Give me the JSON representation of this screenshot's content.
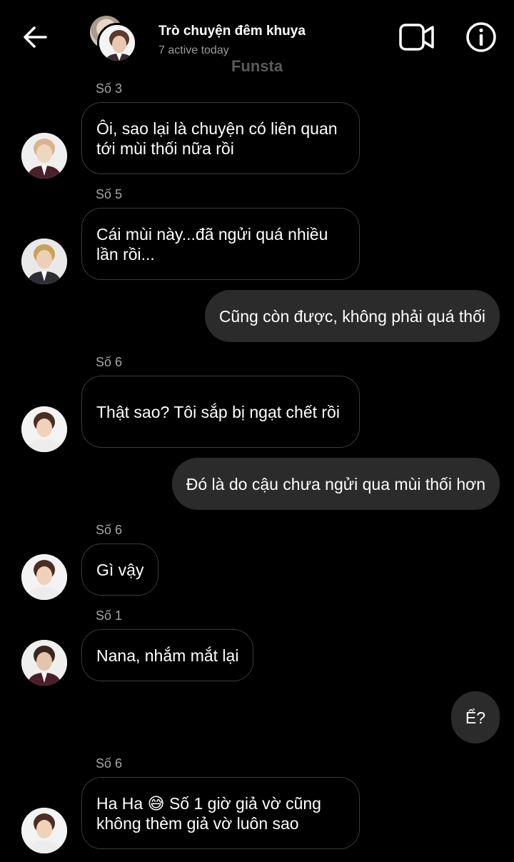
{
  "header": {
    "title": "Trò chuyện đêm khuya",
    "subtitle": "7 active today",
    "watermark": "Funsta",
    "back_icon": "arrow-left-icon",
    "video_icon": "video-camera-icon",
    "info_icon": "info-circle-icon"
  },
  "messages": [
    {
      "sender": "Số 3",
      "text": "Ôi, sao lại là chuyện có liên quan tới mùi thối nữa rồi"
    },
    {
      "sender": "Số 5",
      "text": "Cái mùi này...đã ngửi quá nhiều lần rồi..."
    },
    {
      "text": "Cũng còn được, không phải quá thối"
    },
    {
      "sender": "Số 6",
      "text": "Thật sao? Tôi sắp bị ngạt chết rồi"
    },
    {
      "text": "Đó là do cậu chưa ngửi qua mùi thối hơn"
    },
    {
      "sender": "Số 6",
      "text": "Gì vậy"
    },
    {
      "sender": "Số 1",
      "text": "Nana, nhắm mắt lại"
    },
    {
      "text": "Ể?"
    },
    {
      "sender": "Số 6",
      "text": "Ha Ha 😅 Số 1 giờ giả vờ cũng không thèm giả vờ luôn sao"
    }
  ],
  "colors": {
    "background": "#000000",
    "incoming_border": "#3a3a3a",
    "outgoing_fill": "#2b2b2b",
    "secondary_text": "#a6a6a6"
  }
}
